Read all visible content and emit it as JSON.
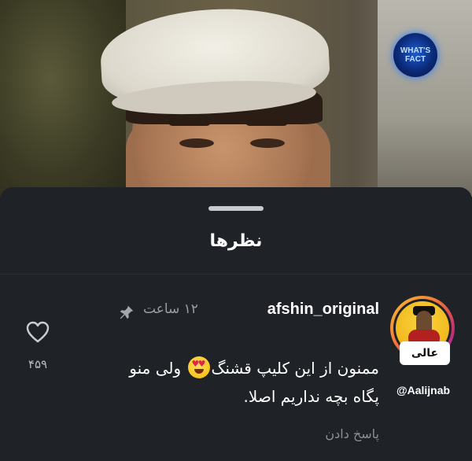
{
  "watermark": {
    "text": "WHAT'S\nFACT"
  },
  "sheet": {
    "title": "نظرها"
  },
  "comment": {
    "username": "afshin_original",
    "time": "۱۲ ساعت",
    "text_part1": "ممنون از این کلیپ قشنگ",
    "text_part2": " ولی منو پگاه بچه نداریم اصلا.",
    "emoji": "heart-eyes-emoji",
    "reply_label": "پاسخ دادن",
    "like_count": "۴۵۹",
    "avatar_badge": "عالی",
    "avatar_handle": "@Aalijnab"
  },
  "icons": {
    "pin": "pin-icon",
    "like": "heart-outline-icon",
    "handle": "drag-handle"
  },
  "colors": {
    "sheet_bg": "#1f2227",
    "text_primary": "#ffffff",
    "text_secondary": "#9a9da3",
    "avatar_ring": "#f36b3c"
  }
}
